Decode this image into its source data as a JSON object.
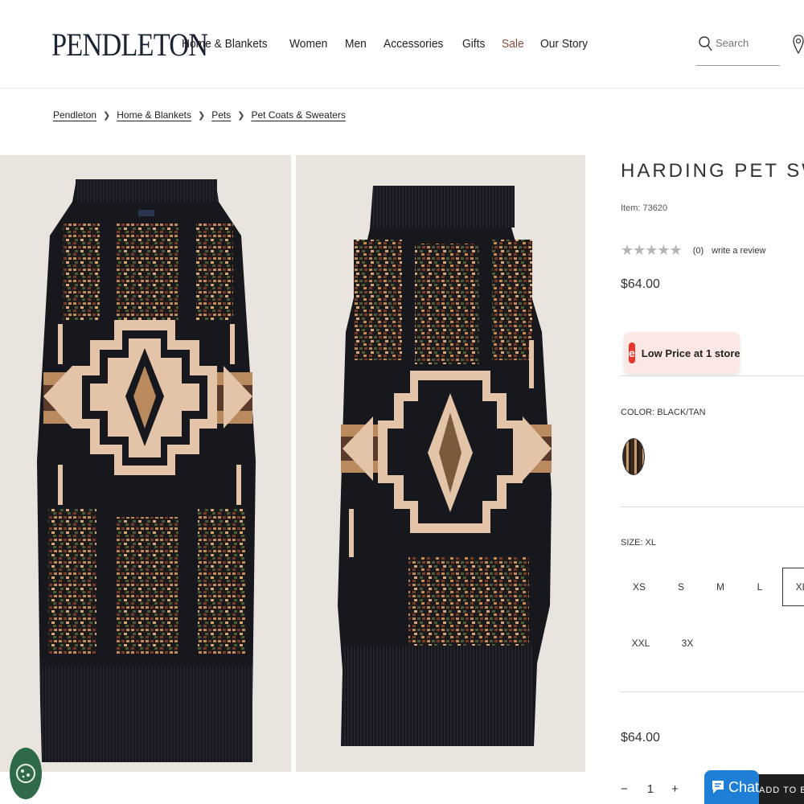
{
  "brand": "PENDLETON",
  "nav": [
    "Home & Blankets",
    "Women",
    "Men",
    "Accessories",
    "Gifts",
    "Sale",
    "Our Story"
  ],
  "search": {
    "placeholder": "Search"
  },
  "breadcrumb": [
    "Pendleton",
    "Home & Blankets",
    "Pets",
    "Pet Coats & Sweaters"
  ],
  "product": {
    "title": "HARDING PET SWE",
    "item": "Item: 73620",
    "review_count": "(0)",
    "write_review": "write a review",
    "price": "$64.00",
    "low_price": "Low Price at 1 store",
    "low_price_badge": "e",
    "color_label": "COLOR: BLACK/TAN",
    "size_label": "SIZE: XL",
    "sizes": [
      "XS",
      "S",
      "M",
      "L",
      "XL",
      "XXL",
      "3X"
    ],
    "selected_size": "XL",
    "price_bottom": "$64.00",
    "qty_minus": "−",
    "qty_value": "1",
    "qty_plus": "+",
    "add_to_bag": "ADD TO BAG"
  },
  "chat": {
    "label": "Chat"
  },
  "colors": {
    "sale": "#8b4a3a",
    "chat": "#1f7fd6",
    "cookie": "#2f6b48",
    "lowprice_bg": "#fde7e4"
  }
}
